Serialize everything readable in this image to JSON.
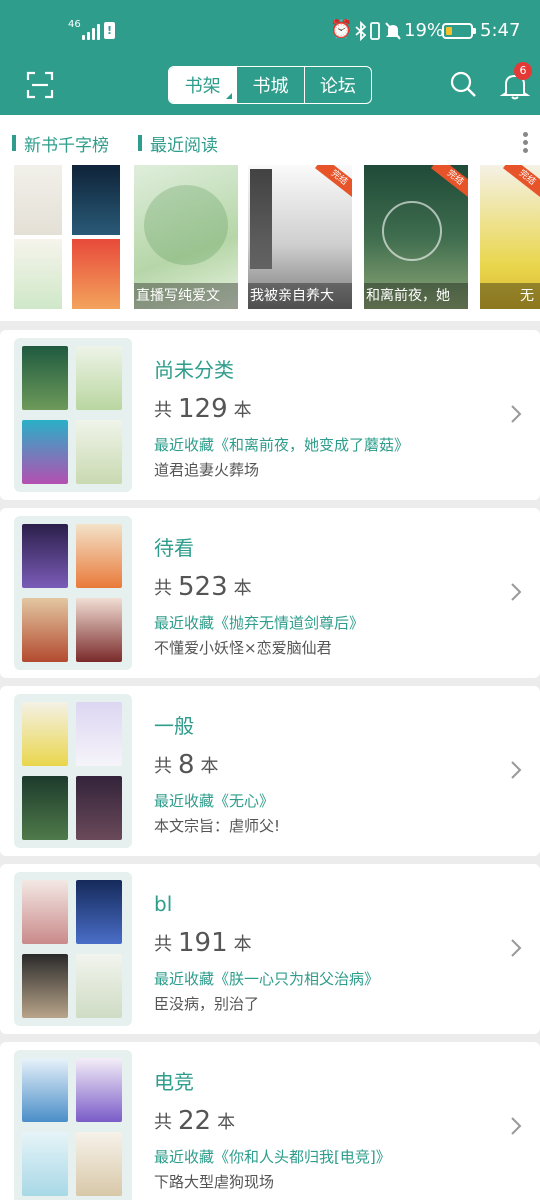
{
  "status_bar": {
    "network": "46",
    "battery_percent": "19%",
    "time": "5:47"
  },
  "app_bar": {
    "tabs": [
      {
        "label": "书架",
        "active": true
      },
      {
        "label": "书城",
        "active": false
      },
      {
        "label": "论坛",
        "active": false
      }
    ],
    "notification_count": "6",
    "icons": [
      "scan-icon",
      "search-icon",
      "bell-icon"
    ]
  },
  "rank_strip": {
    "tabs": [
      "新书千字榜",
      "最近阅读"
    ],
    "books": [
      {
        "caption": ""
      },
      {
        "caption": "直播写纯爱文"
      },
      {
        "caption": "我被亲自养大"
      },
      {
        "caption": "和离前夜，她"
      },
      {
        "caption": "无"
      }
    ]
  },
  "shelves": [
    {
      "title": "尚未分类",
      "prefix": "共",
      "count": "129",
      "unit": "本",
      "recent": "最近收藏《和离前夜，她变成了蘑菇》",
      "desc": "道君追妻火葬场"
    },
    {
      "title": "待看",
      "prefix": "共",
      "count": "523",
      "unit": "本",
      "recent": "最近收藏《抛弃无情道剑尊后》",
      "desc": "不懂爱小妖怪×恋爱脑仙君"
    },
    {
      "title": "一般",
      "prefix": "共",
      "count": "8",
      "unit": "本",
      "recent": "最近收藏《无心》",
      "desc": "本文宗旨：虐师父!"
    },
    {
      "title": "bl",
      "prefix": "共",
      "count": "191",
      "unit": "本",
      "recent": "最近收藏《朕一心只为相父治病》",
      "desc": "臣没病，别治了"
    },
    {
      "title": "电竞",
      "prefix": "共",
      "count": "22",
      "unit": "本",
      "recent": "最近收藏《你和人头都归我[电竞]》",
      "desc": "下路大型虐狗现场"
    }
  ],
  "colors": {
    "accent": "#2e9d8b",
    "badge": "#e53935",
    "background": "#ececec"
  }
}
